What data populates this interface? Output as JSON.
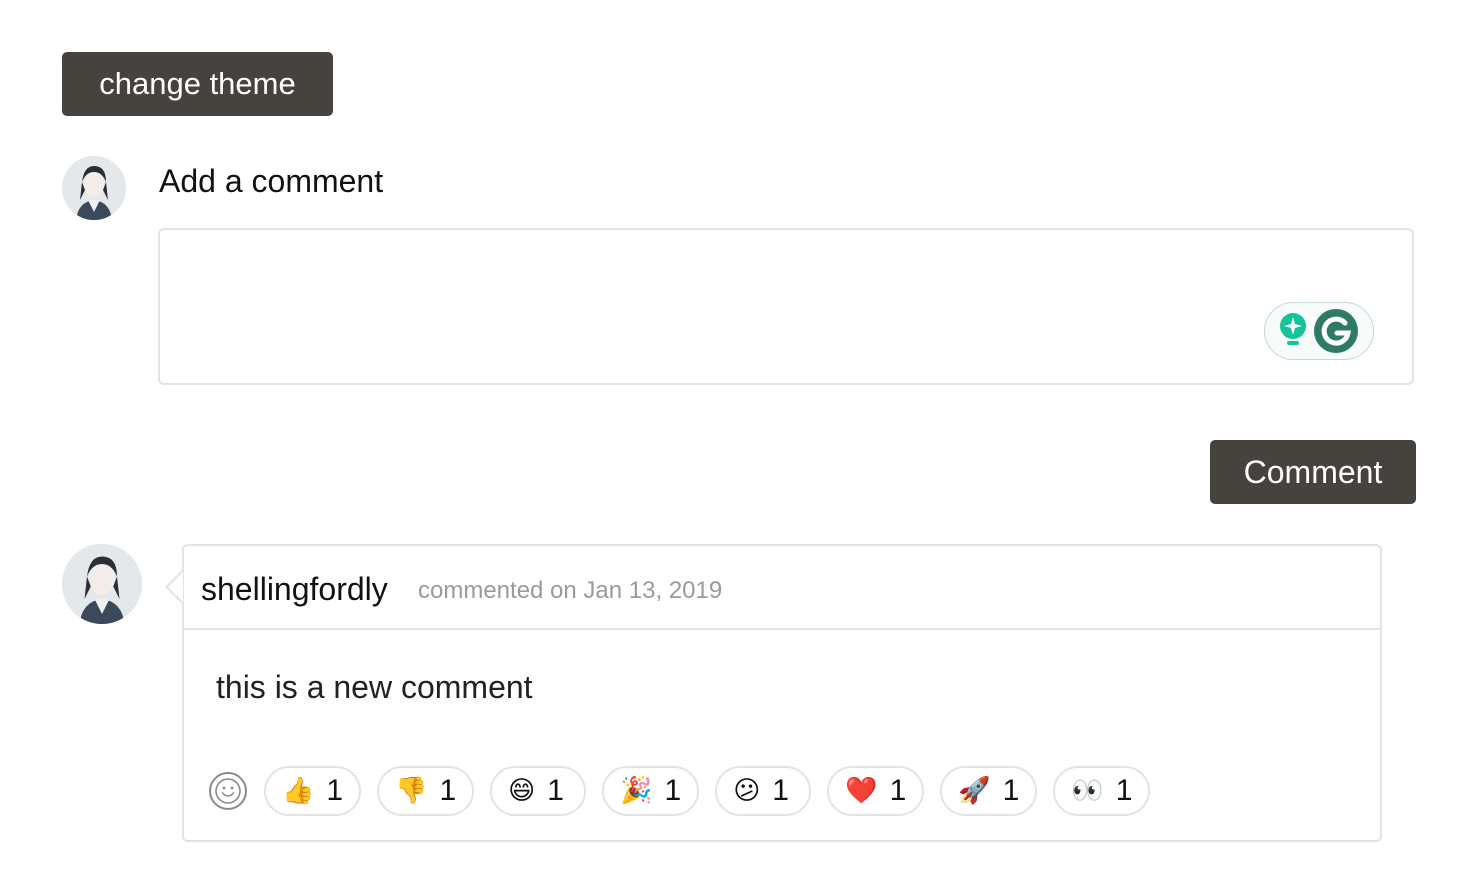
{
  "toolbar": {
    "change_theme_label": "change theme"
  },
  "composer": {
    "heading": "Add a comment",
    "placeholder": "",
    "submit_label": "Comment"
  },
  "comment": {
    "author": "shellingfordly",
    "meta": "commented on Jan 13, 2019",
    "body": "this is a new comment",
    "reactions": [
      {
        "icon": "thumbs-up-icon",
        "emoji": "👍",
        "count": "1"
      },
      {
        "icon": "thumbs-down-icon",
        "emoji": "👎",
        "count": "1"
      },
      {
        "icon": "grinning-face-icon",
        "emoji": "😄",
        "count": "1"
      },
      {
        "icon": "party-popper-icon",
        "emoji": "🎉",
        "count": "1"
      },
      {
        "icon": "confused-face-icon",
        "emoji": "😕",
        "count": "1"
      },
      {
        "icon": "heart-icon",
        "emoji": "❤️",
        "count": "1"
      },
      {
        "icon": "rocket-icon",
        "emoji": "🚀",
        "count": "1"
      },
      {
        "icon": "eyes-icon",
        "emoji": "👀",
        "count": "1"
      }
    ]
  },
  "colors": {
    "button_bg": "#46423e",
    "border": "#e3e3e3",
    "muted_text": "#9a9a9a",
    "grammarly_green": "#15c39a"
  }
}
